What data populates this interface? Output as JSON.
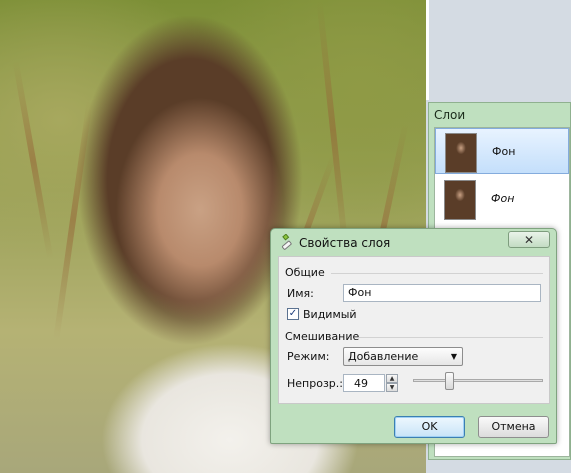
{
  "layers_panel": {
    "title": "Слои",
    "layers": [
      {
        "name": "Фон",
        "selected": true
      },
      {
        "name": "Фон",
        "selected": false,
        "italic": true
      }
    ]
  },
  "dialog": {
    "title": "Свойства слоя",
    "close_symbol": "✕",
    "general_group": "Общие",
    "name_label": "Имя:",
    "name_value": "Фон",
    "visible_label": "Видимый",
    "visible_checked": true,
    "check_mark": "✓",
    "blend_group": "Смешивание",
    "mode_label": "Режим:",
    "mode_value": "Добавление",
    "opacity_label": "Непрозр.:",
    "opacity_value": "49",
    "opacity_fraction": 0.49,
    "ok_label": "OK",
    "cancel_label": "Отмена"
  },
  "colors": {
    "panel_green": "#bfe0bf",
    "selection_blue": "#c4dffb",
    "ok_border": "#3c7fb1"
  }
}
